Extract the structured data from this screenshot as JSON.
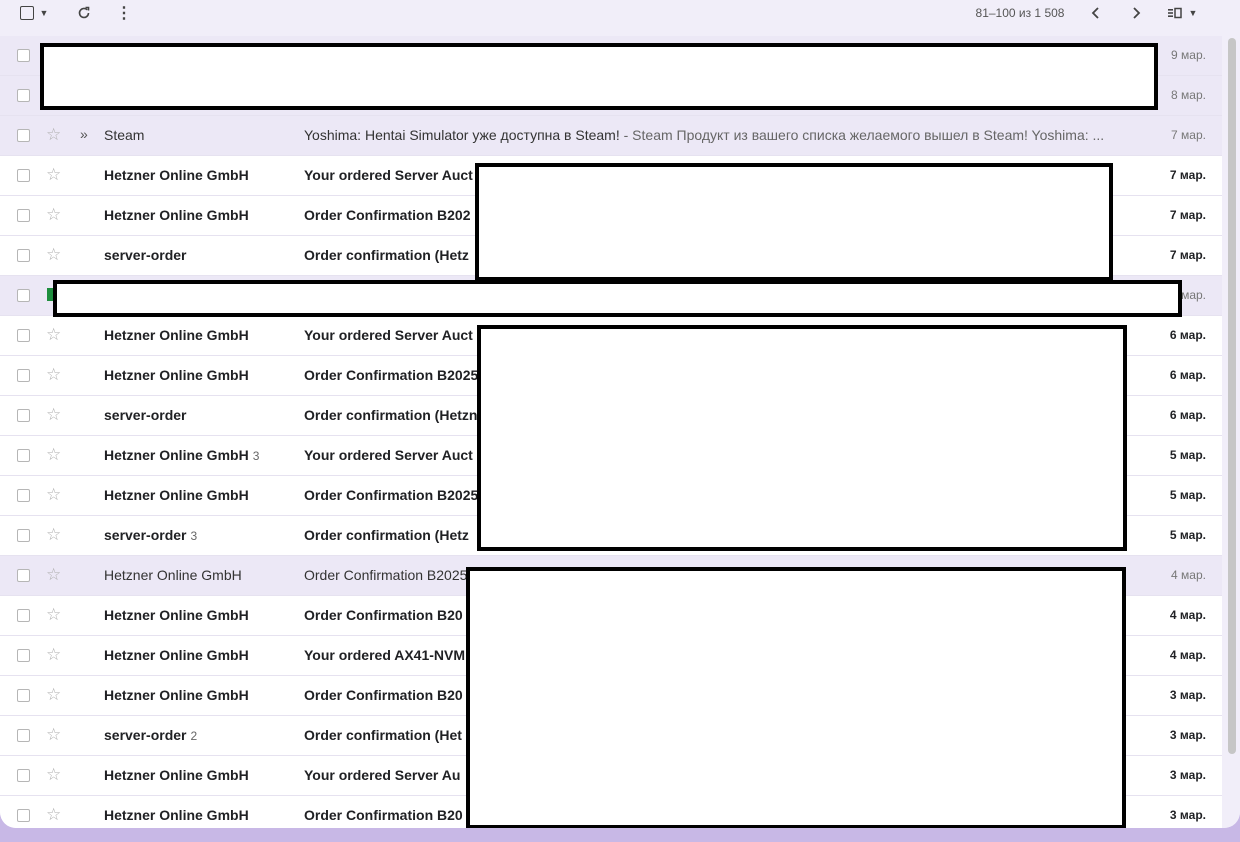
{
  "toolbar": {
    "pager": "81–100 из 1 508",
    "icons": {
      "select": "checkbox-icon",
      "select_menu": "caret-down-icon",
      "refresh": "refresh-icon",
      "more": "more-vert-icon",
      "prev": "chevron-left-icon",
      "next": "chevron-right-icon",
      "split": "split-pane-icon"
    }
  },
  "emails": [
    {
      "sender": "",
      "count": "",
      "subject": "",
      "snippet": "",
      "date": "9 мар.",
      "unread": false
    },
    {
      "sender": "",
      "count": "",
      "subject": "",
      "snippet": "",
      "date": "8 мар.",
      "unread": false
    },
    {
      "sender": "Steam",
      "count": "",
      "subject": "Yoshima: Hentai Simulator уже доступна в Steam!",
      "snippet": " - Steam Продукт из вашего списка желаемого вышел в Steam! Yoshima: ...",
      "date": "7 мар.",
      "unread": false,
      "important": "»"
    },
    {
      "sender": "Hetzner Online GmbH",
      "count": "",
      "subject": "Your ordered Server Auct",
      "snippet": "",
      "date": "7 мар.",
      "unread": true
    },
    {
      "sender": "Hetzner Online GmbH",
      "count": "",
      "subject": "Order Confirmation B202",
      "snippet": "",
      "date": "7 мар.",
      "unread": true
    },
    {
      "sender": "server-order",
      "count": "",
      "subject": "Order confirmation (Hetz",
      "snippet": "",
      "date": "7 мар.",
      "unread": true
    },
    {
      "sender": "",
      "count": "",
      "subject": "",
      "snippet": "",
      "date": "мар.",
      "unread": false
    },
    {
      "sender": "Hetzner Online GmbH",
      "count": "",
      "subject": "Your ordered Server Auct",
      "snippet": "",
      "date": "6 мар.",
      "unread": true
    },
    {
      "sender": "Hetzner Online GmbH",
      "count": "",
      "subject": "Order Confirmation B2025",
      "snippet": "",
      "date": "6 мар.",
      "unread": true
    },
    {
      "sender": "server-order",
      "count": "",
      "subject": "Order confirmation (Hetzn",
      "snippet": "",
      "date": "6 мар.",
      "unread": true
    },
    {
      "sender": "Hetzner Online GmbH",
      "count": "3",
      "subject": "Your ordered Server Auct",
      "snippet": "",
      "date": "5 мар.",
      "unread": true
    },
    {
      "sender": "Hetzner Online GmbH",
      "count": "",
      "subject": "Order Confirmation B2025",
      "snippet": "",
      "date": "5 мар.",
      "unread": true
    },
    {
      "sender": "server-order",
      "count": "3",
      "subject": "Order confirmation (Hetz",
      "snippet": "",
      "date": "5 мар.",
      "unread": true
    },
    {
      "sender": "Hetzner Online GmbH",
      "count": "",
      "subject": "Order Confirmation B2025",
      "snippet": "",
      "date": "4 мар.",
      "unread": false
    },
    {
      "sender": "Hetzner Online GmbH",
      "count": "",
      "subject": "Order Confirmation B20",
      "snippet": "",
      "date": "4 мар.",
      "unread": true
    },
    {
      "sender": "Hetzner Online GmbH",
      "count": "",
      "subject": "Your ordered AX41-NVM",
      "snippet": "",
      "date": "4 мар.",
      "unread": true
    },
    {
      "sender": "Hetzner Online GmbH",
      "count": "",
      "subject": "Order Confirmation B20",
      "snippet": "",
      "date": "3 мар.",
      "unread": true
    },
    {
      "sender": "server-order",
      "count": "2",
      "subject": "Order confirmation (Het",
      "snippet": "",
      "date": "3 мар.",
      "unread": true
    },
    {
      "sender": "Hetzner Online GmbH",
      "count": "",
      "subject": "Your ordered Server Au",
      "snippet": "",
      "date": "3 мар.",
      "unread": true
    },
    {
      "sender": "Hetzner Online GmbH",
      "count": "",
      "subject": "Order Confirmation B20",
      "snippet": "",
      "date": "3 мар.",
      "unread": true
    }
  ]
}
